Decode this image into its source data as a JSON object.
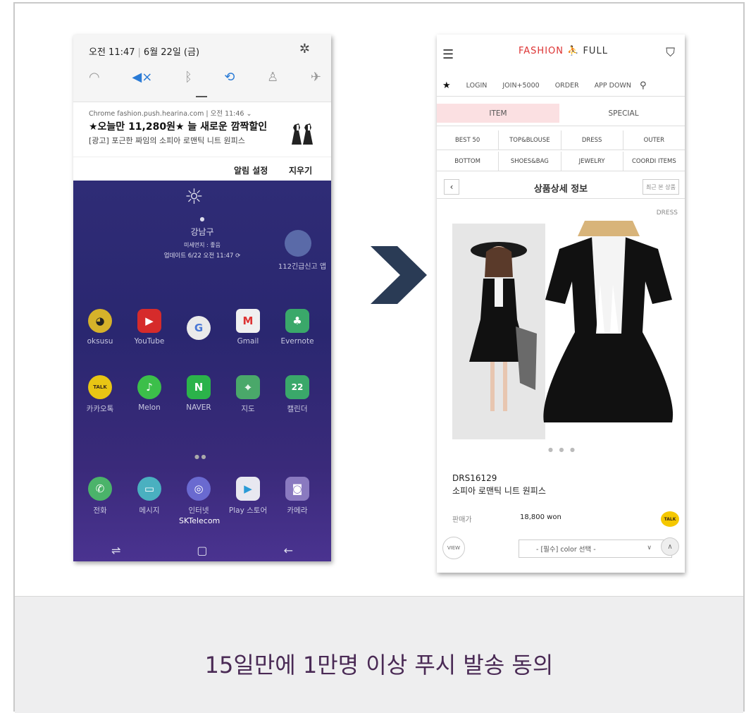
{
  "left_phone": {
    "status_time": "오전 11:47",
    "status_date": "6월 22일 (금)",
    "quick_icons": [
      "wifi-icon",
      "mute-icon",
      "bluetooth-icon",
      "sync-icon",
      "flashlight-icon",
      "airplane-icon"
    ],
    "notification": {
      "source": "Chrome  fashion.push.hearina.com  |  오전 11:46 ⌄",
      "title": "★오늘만 11,280원★ 늘 새로운 깜짝할인",
      "body": "[광고] 포근한 짜임의 소피아 로맨틱 니트 원피스"
    },
    "actions": {
      "settings": "알림 설정",
      "clear": "지우기"
    },
    "weather": {
      "location": "강남구",
      "dust": "미세먼지 : 좋음",
      "updated": "업데이트 6/22 오전 11:47 ⟳"
    },
    "widget_label": "112긴급신고 앱",
    "apps_row1": [
      "oksusu",
      "YouTube",
      "",
      "Gmail",
      "Evernote"
    ],
    "apps_row2": [
      "카카오톡",
      "Melon",
      "NAVER",
      "지도",
      "캘린더"
    ],
    "apps_row3": [
      "전화",
      "메시지",
      "인터넷",
      "Play 스토어",
      "카메라"
    ],
    "carrier": "SKTelecom",
    "app_glyphs": {
      "google": "G",
      "gmail": "M",
      "talk": "TALK",
      "naver": "N",
      "calendar": "22"
    }
  },
  "right_phone": {
    "logo": {
      "part1": "FASHION",
      "part2": "FULL"
    },
    "menu": {
      "login": "LOGIN",
      "join": "JOIN+5000",
      "order": "ORDER",
      "app": "APP DOWN"
    },
    "tabs": {
      "item": "ITEM",
      "special": "SPECIAL"
    },
    "categories_row1": [
      "BEST 50",
      "TOP&BLOUSE",
      "DRESS",
      "OUTER"
    ],
    "categories_row2": [
      "BOTTOM",
      "SHOES&BAG",
      "JEWELRY",
      "COORDI ITEMS"
    ],
    "detail_title": "상품상세 정보",
    "recent_label": "최근 본 상품",
    "category_tag": "DRESS",
    "product_code": "DRS16129",
    "product_name": "소피아 로맨틱 니트 원피스",
    "price_label": "판매가",
    "price": "18,800 won",
    "talk_label": "TALK",
    "view_label": "VIEW",
    "select_placeholder": "- [필수] color 선택 -"
  },
  "caption": "15일만에 1만명 이상 푸시 발송 동의",
  "colors": {
    "arrow": "#2a3b55",
    "caption": "#4a2a55",
    "tab_active": "#fbe0e2"
  }
}
